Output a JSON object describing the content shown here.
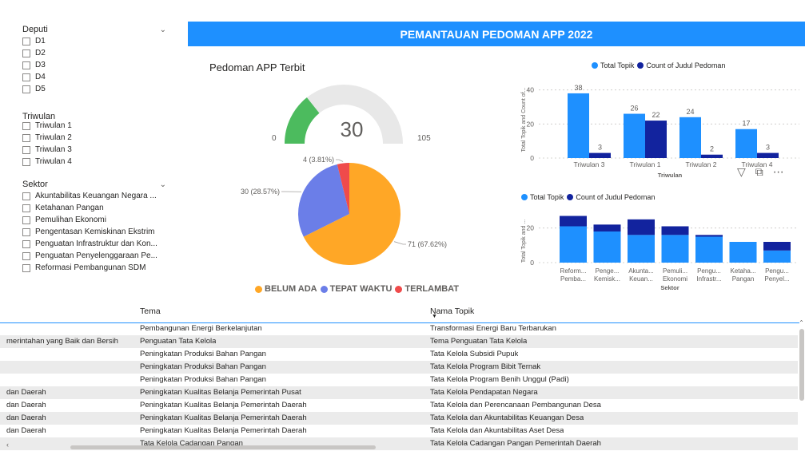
{
  "slicers": {
    "deputi": {
      "title": "Deputi",
      "options": [
        "D1",
        "D2",
        "D3",
        "D4",
        "D5"
      ]
    },
    "triwulan": {
      "title": "Triwulan",
      "options": [
        "Triwulan 1",
        "Triwulan 2",
        "Triwulan 3",
        "Triwulan 4"
      ]
    },
    "sektor": {
      "title": "Sektor",
      "options": [
        "Akuntabilitas Keuangan Negara ...",
        "Ketahanan Pangan",
        "Pemulihan Ekonomi",
        "Pengentasan Kemiskinan Ekstrim",
        "Penguatan Infrastruktur dan Kon...",
        "Penguatan Penyelenggaraan Pe...",
        "Reformasi Pembangunan SDM"
      ]
    }
  },
  "banner": {
    "title": "PEMANTAUAN PEDOMAN APP 2022"
  },
  "gauge": {
    "title": "Pedoman APP Terbit",
    "value": 30,
    "min": 0,
    "max": 105,
    "fill_fraction": 0.2857,
    "value_label": "30",
    "min_label": "0",
    "max_label": "105",
    "fill_color": "#4cbb5e",
    "track_color": "#e8e8e8"
  },
  "pie": {
    "slice_labels": [
      "71 (67.62%)",
      "30 (28.57%)",
      "4 (3.81%)"
    ],
    "legend": [
      "BELUM ADA",
      "TEPAT WAKTU",
      "TERLAMBAT"
    ]
  },
  "bar_triwulan": {
    "legend": [
      "Total Topik",
      "Count of Judul Pedoman"
    ],
    "ylabel": "Total Topik and Count of...",
    "xlabel": "Triwulan",
    "ticks": [
      "0",
      "20",
      "40"
    ]
  },
  "bar_sektor": {
    "legend": [
      "Total Topik",
      "Count of Judul Pedoman"
    ],
    "ylabel": "Total Topik and ...",
    "xlabel": "Sektor",
    "ticks": [
      "0",
      "20"
    ],
    "cat_line1": [
      "Reform...",
      "Penge...",
      "Akunta...",
      "Pemuli...",
      "Pengu...",
      "Ketaha...",
      "Pengu..."
    ],
    "cat_line2": [
      "Pemba...",
      "Kemisk...",
      "Keuan...",
      "Ekonomi",
      "Infrastr...",
      "Pangan",
      "Penyel..."
    ]
  },
  "chart_data": [
    {
      "type": "pie",
      "categories": [
        "BELUM ADA",
        "TEPAT WAKTU",
        "TERLAMBAT"
      ],
      "values": [
        71,
        30,
        4
      ],
      "percentages": [
        67.62,
        28.57,
        3.81
      ],
      "colors": [
        "#ffa726",
        "#6b7ee8",
        "#ef4b4b"
      ],
      "legend_position": "bottom"
    },
    {
      "type": "bar",
      "categories": [
        "Triwulan 3",
        "Triwulan 1",
        "Triwulan 2",
        "Triwulan 4"
      ],
      "series": [
        {
          "name": "Total Topik",
          "values": [
            38,
            26,
            24,
            17
          ],
          "color": "#1e90ff"
        },
        {
          "name": "Count of Judul Pedoman",
          "values": [
            3,
            22,
            2,
            3
          ],
          "color": "#12239e"
        }
      ],
      "xlabel": "Triwulan",
      "ylabel": "Total Topik and Count of...",
      "ylim": [
        0,
        45
      ],
      "data_labels": true,
      "grid": true,
      "legend_position": "top"
    },
    {
      "type": "bar",
      "stacked": true,
      "categories": [
        "Reform... Pemba...",
        "Penge... Kemisk...",
        "Akunta... Keuan...",
        "Pemuli... Ekonomi",
        "Pengu... Infrastr...",
        "Ketaha... Pangan",
        "Pengu... Penyel..."
      ],
      "series": [
        {
          "name": "Total Topik",
          "values": [
            21,
            18,
            16,
            16,
            15,
            12,
            7
          ],
          "color": "#1e90ff"
        },
        {
          "name": "Count of Judul Pedoman",
          "values": [
            6,
            4,
            9,
            5,
            1,
            0,
            5
          ],
          "color": "#12239e"
        }
      ],
      "xlabel": "Sektor",
      "ylabel": "Total Topik and ...",
      "ylim": [
        0,
        30
      ],
      "grid": true,
      "legend_position": "top"
    }
  ],
  "table": {
    "headers": [
      "Tema",
      "Nama Topik"
    ],
    "rows": [
      [
        "",
        "Pembangunan Energi Berkelanjutan",
        "Transformasi Energi Baru Terbarukan"
      ],
      [
        "merintahan yang Baik dan Bersih",
        "Penguatan Tata Kelola",
        "Tema Penguatan Tata Kelola"
      ],
      [
        "",
        "Peningkatan Produksi Bahan Pangan",
        "Tata Kelola Subsidi Pupuk"
      ],
      [
        "",
        "Peningkatan Produksi Bahan Pangan",
        "Tata Kelola Program Bibit Ternak"
      ],
      [
        "",
        "Peningkatan Produksi Bahan Pangan",
        "Tata Kelola Program Benih Unggul (Padi)"
      ],
      [
        "dan Daerah",
        "Peningkatan Kualitas Belanja Pemerintah Pusat",
        "Tata Kelola Pendapatan Negara"
      ],
      [
        "dan Daerah",
        "Peningkatan Kualitas Belanja Pemerintah Daerah",
        "Tata Kelola dan Perencanaan Pembangunan Desa"
      ],
      [
        "dan Daerah",
        "Peningkatan Kualitas Belanja Pemerintah Daerah",
        "Tata Kelola dan Akuntabilitas Keuangan Desa"
      ],
      [
        "dan Daerah",
        "Peningkatan Kualitas Belanja Pemerintah Daerah",
        "Tata Kelola dan Akuntabilitas Aset Desa"
      ],
      [
        "",
        "Tata Kelola Cadangan Pangan",
        "Tata Kelola Cadangan Pangan Pemerintah Daerah"
      ]
    ]
  },
  "icons": {
    "chevron": "chevron-down-icon",
    "filter": "filter-icon",
    "focus": "focus-mode-icon",
    "more": "more-options-icon"
  }
}
